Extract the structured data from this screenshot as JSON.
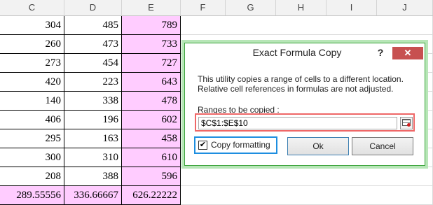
{
  "columns": [
    "C",
    "D",
    "E",
    "F",
    "G",
    "H",
    "I",
    "J"
  ],
  "rows": [
    [
      "304",
      "485",
      "789"
    ],
    [
      "260",
      "473",
      "733"
    ],
    [
      "273",
      "454",
      "727"
    ],
    [
      "420",
      "223",
      "643"
    ],
    [
      "140",
      "338",
      "478"
    ],
    [
      "406",
      "196",
      "602"
    ],
    [
      "295",
      "163",
      "458"
    ],
    [
      "300",
      "310",
      "610"
    ],
    [
      "208",
      "388",
      "596"
    ],
    [
      "289.55556",
      "336.66667",
      "626.22222"
    ]
  ],
  "dialog": {
    "title": "Exact Formula Copy",
    "help": "?",
    "close": "✕",
    "description_line1": "This utility copies a range of cells to a different location.",
    "description_line2": "Relative cell references in formulas are not adjusted.",
    "ranges_label": "Ranges to be copied :",
    "range_value": "$C$1:$E$10",
    "copy_formatting_label": "Copy formatting",
    "copy_formatting_checked": true,
    "ok_label": "Ok",
    "cancel_label": "Cancel"
  },
  "colors": {
    "highlight_pink": "#ffccff",
    "dialog_border": "#3fa53f",
    "range_outline": "#ef6767",
    "checkbox_outline": "#1e8ee0",
    "close_button": "#c75050"
  }
}
